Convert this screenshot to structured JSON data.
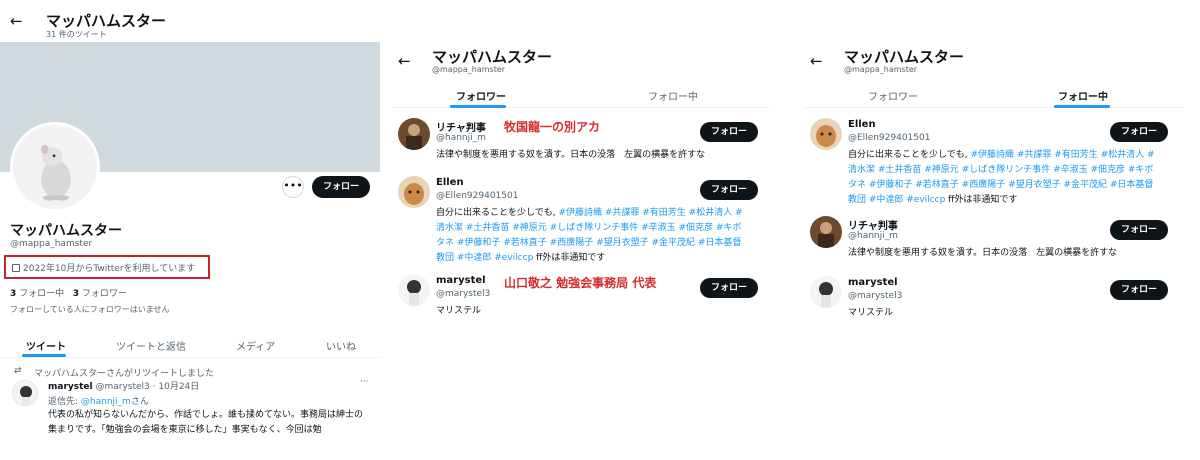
{
  "colors": {
    "accent": "#1d9bf0",
    "highlight": "#c0262b",
    "annotation": "#d62b2b",
    "button_bg": "#0f1419"
  },
  "panel1": {
    "back_icon": "arrow-left",
    "header_name": "マッパハムスター",
    "header_count": "31 件のツイート",
    "more_icon": "more-horizontal",
    "follow": "フォロー",
    "name": "マッパハムスター",
    "handle": "@mappa_hamster",
    "joined_icon": "calendar",
    "joined": "2022年10月からTwitterを利用しています",
    "following_count": "3",
    "following_label": " フォロー中",
    "followers_count": "3",
    "followers_label": " フォロワー",
    "not_followed": "フォローしている人にフォロワーはいません",
    "tabs": [
      "ツイート",
      "ツイートと返信",
      "メディア",
      "いいね"
    ],
    "retweet_icon": "retweet",
    "retweet_label": "マッパハムスターさんがリツイートしました",
    "tweet": {
      "name": "marystel",
      "handle": "@marystel3",
      "date": "· 10月24日",
      "dots": "···",
      "reply_prefix": "返信先: ",
      "reply_to": "@hannji_m",
      "reply_suffix": "さん",
      "body": "代表の私が知らないんだから、作話でしょ。誰も揉めてない。事務局は紳士の集まりです。「勉強会の会場を東京に移した」事実もなく、今回は勉"
    }
  },
  "panel2": {
    "back_icon": "arrow-left",
    "header_name": "マッパハムスター",
    "header_handle": "@mappa_hamster",
    "tabs": [
      "フォロワー",
      "フォロー中"
    ],
    "active_tab": 0,
    "users": [
      {
        "name": "リチャ判事",
        "handle": "@hannji_m",
        "follow": "フォロー",
        "bio": "法律や制度を悪用する奴を潰す。日本の没落　左翼の横暴を許すな",
        "note": "牧国龍一の別アカ"
      },
      {
        "name": "Ellen",
        "handle": "@Ellen929401501",
        "follow": "フォロー",
        "bio_pre": "自分に出来ることを少しでも, ",
        "tags": "#伊藤詩織 #共謀罪 #有田芳生 #松井清人 #清水潔 #土井香苗 #神原元 #しばき隊リンチ事件 #辛淑玉 #佃克彦 #キボタネ #伊藤和子 #若林直子 #西廣陽子 #望月衣塑子 #金平茂紀 #日本基督教団 #中達郎 #evilccp",
        "bio_post": " ff外は非通知です"
      },
      {
        "name": "marystel",
        "handle": "@marystel3",
        "follow": "フォロー",
        "bio": "マリステル",
        "note": "山口敬之 勉強会事務局 代表"
      }
    ]
  },
  "panel3": {
    "back_icon": "arrow-left",
    "header_name": "マッパハムスター",
    "header_handle": "@mappa_hamster",
    "tabs": [
      "フォロワー",
      "フォロー中"
    ],
    "active_tab": 1,
    "users": [
      {
        "name": "Ellen",
        "handle": "@Ellen929401501",
        "follow": "フォロー",
        "bio_pre": "自分に出来ることを少しでも, ",
        "tags": "#伊藤詩織 #共謀罪 #有田芳生 #松井清人 #清水潔 #土井香苗 #神原元 #しばき隊リンチ事件 #辛淑玉 #佃克彦 #キボタネ #伊藤和子 #若林直子 #西廣陽子 #望月衣塑子 #金平茂紀 #日本基督教団 #中達郎 #evilccp",
        "bio_post": " ff外は非通知です"
      },
      {
        "name": "リチャ判事",
        "handle": "@hannji_m",
        "follow": "フォロー",
        "bio": "法律や制度を悪用する奴を潰す。日本の没落　左翼の横暴を許すな"
      },
      {
        "name": "marystel",
        "handle": "@marystel3",
        "follow": "フォロー",
        "bio": "マリステル"
      }
    ]
  }
}
